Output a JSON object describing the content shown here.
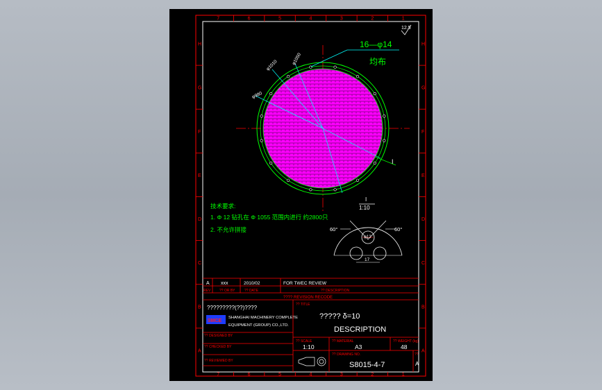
{
  "colors": {
    "background": "#a9afb7",
    "sheet": "#000000",
    "frame": "#ff0000",
    "drawing": "#00ff00",
    "center_line": "#ff0000",
    "dim": "#00ffff",
    "fill": "#ff00ff",
    "text": "#ffffff",
    "note": "#ffff00"
  },
  "grid": {
    "cols": [
      "7",
      "6",
      "5",
      "4",
      "3",
      "2",
      "1"
    ],
    "rows": [
      "H",
      "G",
      "F",
      "E",
      "D",
      "C",
      "B",
      "A"
    ]
  },
  "roughness": "12.5",
  "holes_label": "16—φ14",
  "holes_note": "均布",
  "dims": {
    "d1": "φ1050",
    "d2": "φ1010",
    "d3": "φ980"
  },
  "section_label": "I",
  "detail": {
    "label": "I",
    "scale": "1:10",
    "angle_left": "60°",
    "angle_right": "60°",
    "hole_dia": "φ12",
    "pitch": "17"
  },
  "notes": {
    "title": "技术要求:",
    "line1": "1. Φ 12 钻孔在 Φ 1055 范围内进行 约2800只",
    "line2": "2. 不允许拼接"
  },
  "revision": {
    "row": {
      "rev": "A",
      "by": "xxx",
      "date": "2010/02",
      "description": "FOR TWEC REVIEW"
    },
    "headers": {
      "rev": "REV",
      "by": "?? OR BY",
      "date": "?? DATE",
      "description": "?? DESCRIPTION"
    },
    "caption": "???? REVISION RECODE"
  },
  "company": {
    "cn": "?????????(??)????",
    "logo": "SMCE",
    "en_line1": "SHANGHAI MACHINERY COMPLETE",
    "en_line2": "EQUIPMENT (GROUP) CO.,LTD."
  },
  "title_block": {
    "title_label": "?? TITLE",
    "title_cn": "????? δ=10",
    "title_en": "DESCRIPTION",
    "designed_by": "?? DESIGNED BY",
    "checked_by": "?? CHECKED BY",
    "reviewed_by": "?? REVIEWED BY",
    "scale_label": "?? SCALE",
    "scale": "1:10",
    "material_label": "?? MATERIAL",
    "size": "A3",
    "weight_label": "?? WEIGHT (kg)",
    "weight": "48",
    "drawing_no_label": "?? DRAWING NO.",
    "drawing_no": "S8015-4-7",
    "rev_label": "??",
    "rev": "A"
  }
}
